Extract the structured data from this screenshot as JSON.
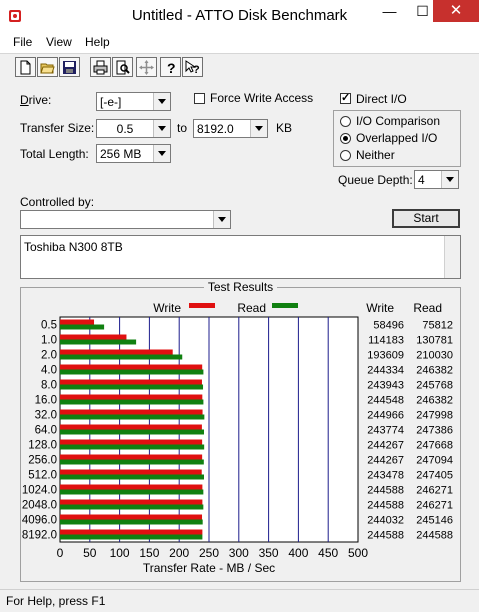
{
  "window": {
    "title": "Untitled - ATTO Disk Benchmark",
    "minimize": "—",
    "maximize": "☐",
    "close": "✕"
  },
  "menu": {
    "file": "File",
    "view": "View",
    "help": "Help"
  },
  "toolbar": {
    "icons": [
      "new-file-icon",
      "open-folder-icon",
      "save-icon",
      "print-icon",
      "print-preview-icon",
      "move-icon",
      "help-icon",
      "context-help-icon"
    ]
  },
  "form": {
    "drive_label": "Drive:",
    "drive_value": "[-e-]",
    "force_write_label": "Force Write Access",
    "force_write_checked": false,
    "direct_io_label": "Direct I/O",
    "direct_io_checked": true,
    "transfer_size_label": "Transfer Size:",
    "transfer_from": "0.5",
    "to_label": "to",
    "transfer_to": "8192.0",
    "kb_label": "KB",
    "total_length_label": "Total Length:",
    "total_length_value": "256 MB",
    "io_comparison_label": "I/O Comparison",
    "overlapped_io_label": "Overlapped I/O",
    "neither_label": "Neither",
    "io_mode_selected": "Overlapped I/O",
    "queue_depth_label": "Queue Depth:",
    "queue_depth_value": "4",
    "controlled_by_label": "Controlled by:",
    "controlled_by_value": "",
    "start_label": "Start",
    "description": "Toshiba N300 8TB"
  },
  "results": {
    "title": "Test Results",
    "write_legend": "Write",
    "read_legend": "Read",
    "write_col_header": "Write",
    "read_col_header": "Read",
    "rows": [
      {
        "size": "0.5",
        "write": "58496",
        "read": "75812"
      },
      {
        "size": "1.0",
        "write": "114183",
        "read": "130781"
      },
      {
        "size": "2.0",
        "write": "193609",
        "read": "210030"
      },
      {
        "size": "4.0",
        "write": "244334",
        "read": "246382"
      },
      {
        "size": "8.0",
        "write": "243943",
        "read": "245768"
      },
      {
        "size": "16.0",
        "write": "244548",
        "read": "246382"
      },
      {
        "size": "32.0",
        "write": "244966",
        "read": "247998"
      },
      {
        "size": "64.0",
        "write": "243774",
        "read": "247386"
      },
      {
        "size": "128.0",
        "write": "244267",
        "read": "247668"
      },
      {
        "size": "256.0",
        "write": "244267",
        "read": "247094"
      },
      {
        "size": "512.0",
        "write": "243478",
        "read": "247405"
      },
      {
        "size": "1024.0",
        "write": "244588",
        "read": "246271"
      },
      {
        "size": "2048.0",
        "write": "244588",
        "read": "246271"
      },
      {
        "size": "4096.0",
        "write": "244032",
        "read": "245146"
      },
      {
        "size": "8192.0",
        "write": "244588",
        "read": "244588"
      }
    ],
    "xlabel": "Transfer Rate - MB / Sec",
    "xticks": [
      "0",
      "50",
      "100",
      "150",
      "200",
      "250",
      "300",
      "350",
      "400",
      "450",
      "500"
    ]
  },
  "chart_data": {
    "type": "bar",
    "orientation": "horizontal",
    "title": "Test Results",
    "xlabel": "Transfer Rate - MB / Sec",
    "xlim": [
      0,
      500
    ],
    "categories": [
      "0.5",
      "1.0",
      "2.0",
      "4.0",
      "8.0",
      "16.0",
      "32.0",
      "64.0",
      "128.0",
      "256.0",
      "512.0",
      "1024.0",
      "2048.0",
      "4096.0",
      "8192.0"
    ],
    "series": [
      {
        "name": "Write",
        "color": "#e01010",
        "values": [
          57.1,
          111.5,
          189.1,
          238.6,
          238.2,
          238.8,
          239.2,
          238.1,
          238.5,
          238.5,
          237.8,
          238.9,
          238.9,
          238.3,
          238.9
        ]
      },
      {
        "name": "Read",
        "color": "#108010",
        "values": [
          74.0,
          127.7,
          205.1,
          240.6,
          240.0,
          240.6,
          242.2,
          241.6,
          241.9,
          241.3,
          241.6,
          240.5,
          240.5,
          239.4,
          238.9
        ]
      }
    ],
    "grid": true
  },
  "status": {
    "text": "For Help, press F1"
  }
}
